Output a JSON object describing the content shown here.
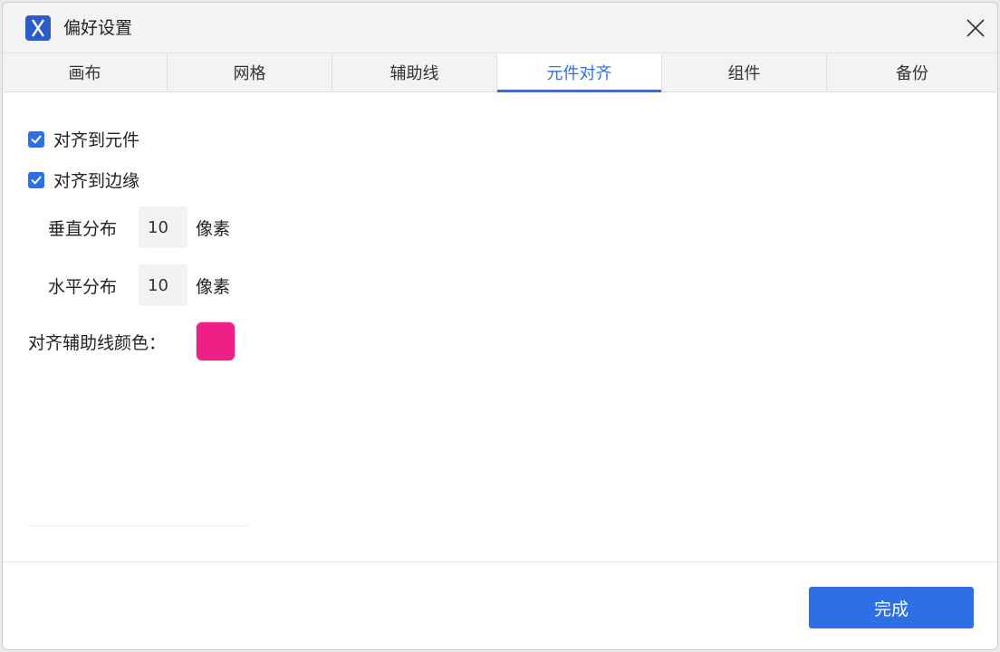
{
  "window": {
    "title": "偏好设置",
    "icon": "x-logo-icon",
    "close_icon": "close-icon"
  },
  "tabs": [
    {
      "label": "画布",
      "active": false
    },
    {
      "label": "网格",
      "active": false
    },
    {
      "label": "辅助线",
      "active": false
    },
    {
      "label": "元件对齐",
      "active": true
    },
    {
      "label": "组件",
      "active": false
    },
    {
      "label": "备份",
      "active": false
    }
  ],
  "options": {
    "snap_to_widgets": {
      "label": "对齐到元件",
      "checked": true
    },
    "snap_to_edges": {
      "label": "对齐到边缘",
      "checked": true
    }
  },
  "fields": {
    "vertical": {
      "label": "垂直分布",
      "value": "10",
      "unit": "像素"
    },
    "horizontal": {
      "label": "水平分布",
      "value": "10",
      "unit": "像素"
    }
  },
  "guide_color": {
    "label": "对齐辅助线颜色：",
    "value": "#ee1f85"
  },
  "footer": {
    "done_label": "完成"
  },
  "colors": {
    "accent": "#2f6fe6",
    "brand": "#2c5cc5"
  }
}
